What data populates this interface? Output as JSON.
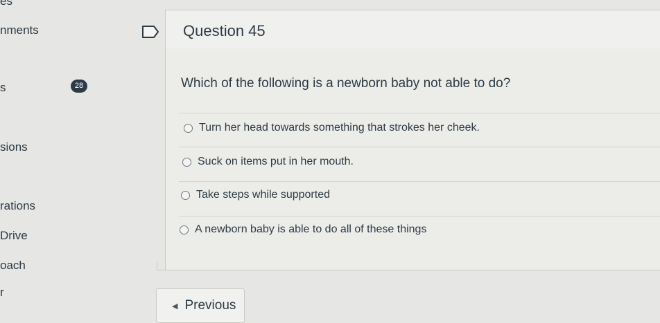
{
  "sidebar": {
    "items": [
      {
        "label": "es"
      },
      {
        "label": "nments"
      },
      {
        "label": "s"
      },
      {
        "label": "sions"
      },
      {
        "label": "rations"
      },
      {
        "label": "Drive"
      },
      {
        "label": "oach"
      },
      {
        "label": "r"
      }
    ],
    "badge": "28"
  },
  "question": {
    "title": "Question 45",
    "text": "Which of the following is a newborn baby not able to do?",
    "answers": [
      {
        "label": "Turn her head towards something that strokes her cheek."
      },
      {
        "label": "Suck on items put in her mouth."
      },
      {
        "label": "Take steps while supported"
      },
      {
        "label": "A newborn baby is able to do all of these things"
      }
    ]
  },
  "nav": {
    "previous_label": "Previous",
    "previous_icon": "triangle-left-icon"
  }
}
